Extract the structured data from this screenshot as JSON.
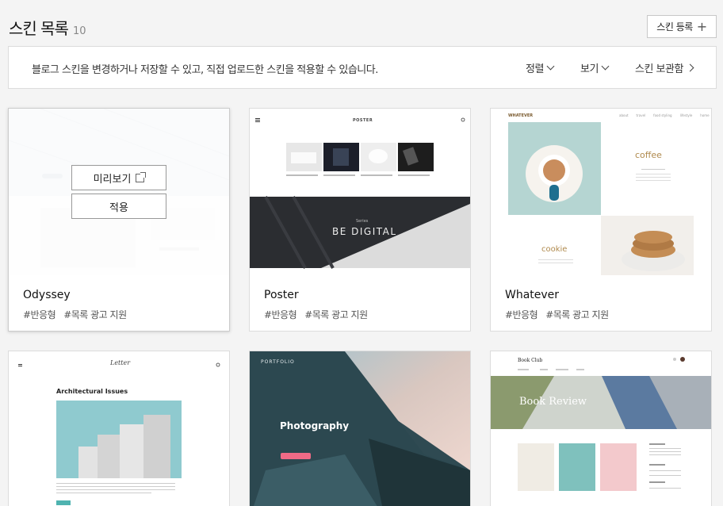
{
  "header": {
    "title": "스킨 목록",
    "count": "10",
    "register_label": "스킨 등록",
    "register_icon": "plus-icon"
  },
  "infobar": {
    "description": "블로그 스킨을 변경하거나 저장할 수 있고, 직접 업로드한 스킨을 적용할 수 있습니다.",
    "sort_label": "정렬",
    "view_label": "보기",
    "storage_label": "스킨 보관함"
  },
  "overlay": {
    "preview_label": "미리보기",
    "apply_label": "적용"
  },
  "skins": [
    {
      "name": "Odyssey",
      "tag1": "#반응형",
      "tag2": "#목록 광고 지원"
    },
    {
      "name": "Poster",
      "tag1": "#반응형",
      "tag2": "#목록 광고 지원"
    },
    {
      "name": "Whatever",
      "tag1": "#반응형",
      "tag2": "#목록 광고 지원"
    }
  ],
  "thumbs": {
    "poster_logo": "POSTER",
    "poster_hero_small": "Series",
    "poster_hero": "BE DIGITAL",
    "whatever_logo": "WHATEVER",
    "whatever_menu": [
      "about",
      "travel",
      "food styling",
      "lifestyle",
      "home"
    ],
    "whatever_coffee": "coffee",
    "whatever_cookie": "cookie",
    "letter_logo": "Letter",
    "letter_heading": "Architectural Issues",
    "portfolio_logo": "PORTFOLIO",
    "portfolio_heading": "Photography",
    "bookclub_logo": "Book Club",
    "bookclub_hero": "Book Review"
  },
  "colors": {
    "accent_pink": "#f06a86",
    "coffee_gold": "#b08a4e",
    "teal_dark": "#2f4a52"
  }
}
